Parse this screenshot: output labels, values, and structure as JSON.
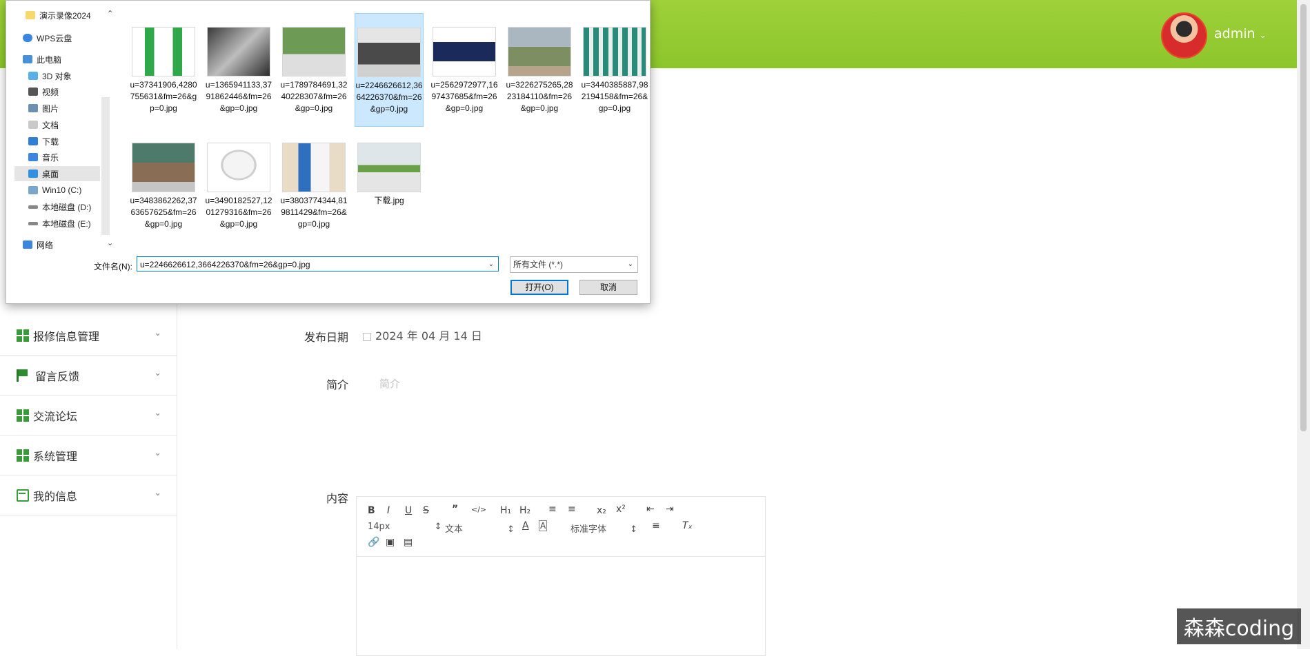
{
  "header": {
    "username": "admin"
  },
  "sidebar": {
    "items": [
      {
        "label": "报修信息管理",
        "icon": "grid-icon"
      },
      {
        "label": "留言反馈",
        "icon": "flag-icon"
      },
      {
        "label": "交流论坛",
        "icon": "grid-icon"
      },
      {
        "label": "系统管理",
        "icon": "grid-icon"
      },
      {
        "label": "我的信息",
        "icon": "card-icon"
      }
    ]
  },
  "form": {
    "publish_date_label": "发布日期",
    "publish_date_value": "2024 年 04 月 14 日",
    "intro_label": "简介",
    "intro_placeholder": "简介",
    "content_label": "内容"
  },
  "editor": {
    "font_size": "14px",
    "block_type": "文本",
    "font_family": "标准字体"
  },
  "watermark": "森森coding",
  "dialog": {
    "nav": [
      "演示录像2024",
      "WPS云盘",
      "此电脑",
      "3D 对象",
      "视频",
      "图片",
      "文档",
      "下载",
      "音乐",
      "桌面",
      "Win10 (C:)",
      "本地磁盘 (D:)",
      "本地磁盘 (E:)",
      "网络"
    ],
    "files": [
      {
        "name": "u=37341906,4280755631&fm=26&gp=0.jpg"
      },
      {
        "name": "u=1365941133,3791862446&fm=26&gp=0.jpg"
      },
      {
        "name": "u=1789784691,3240228307&fm=26&gp=0.jpg"
      },
      {
        "name": "u=2246626612,3664226370&fm=26&gp=0.jpg",
        "selected": true
      },
      {
        "name": "u=2562972977,1697437685&fm=26&gp=0.jpg"
      },
      {
        "name": "u=3226275265,2823184110&fm=26&gp=0.jpg"
      },
      {
        "name": "u=3440385887,982194158&fm=26&gp=0.jpg"
      },
      {
        "name": "u=3483862262,3763657625&fm=26&gp=0.jpg"
      },
      {
        "name": "u=3490182527,1201279316&fm=26&gp=0.jpg"
      },
      {
        "name": "u=3803774344,819811429&fm=26&gp=0.jpg"
      },
      {
        "name": "下载.jpg"
      }
    ],
    "filename_label": "文件名(N):",
    "filename_value": "u=2246626612,3664226370&fm=26&gp=0.jpg",
    "filetype_value": "所有文件 (*.*)",
    "open_label": "打开(O)",
    "cancel_label": "取消"
  },
  "colors": {
    "topbar": "#9fd13a",
    "accent_green": "#3a9a3a",
    "dialog_selection": "#cce8ff",
    "primary_border": "#0078d7"
  }
}
